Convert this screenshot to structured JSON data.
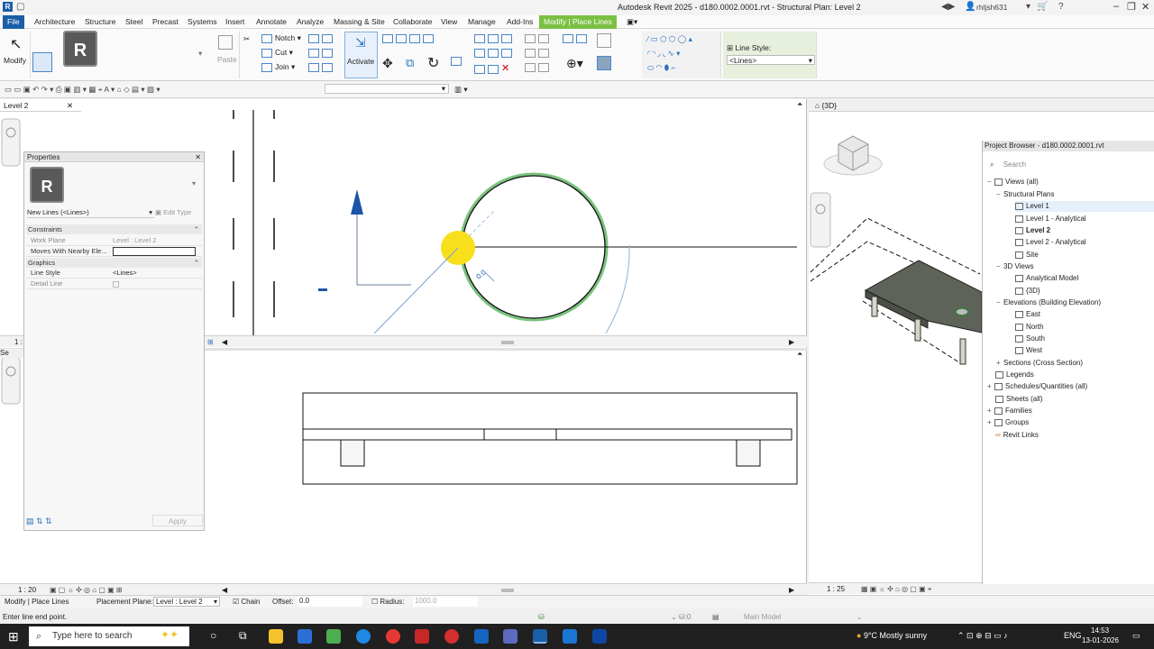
{
  "titlebar": {
    "title": "Autodesk Revit 2025 - d180.0002.0001.rvt - Structural Plan: Level 2",
    "user": "rhljsh631",
    "app_letter": "R"
  },
  "menu": {
    "tabs": [
      "File",
      "Architecture",
      "Structure",
      "Steel",
      "Precast",
      "Systems",
      "Insert",
      "Annotate",
      "Analyze",
      "Massing & Site",
      "Collaborate",
      "View",
      "Manage",
      "Add-Ins",
      "Modify | Place Lines"
    ]
  },
  "ribbon": {
    "modify_label": "Modify",
    "paste_label": "Paste",
    "notch_label": "Notch",
    "cut_label": "Cut",
    "join_label": "Join",
    "activate_label": "Activate",
    "line_style_label": "Line Style:",
    "line_style_value": "<Lines>"
  },
  "view_level2": {
    "tab_label": "Level 2",
    "scale": "1 : 20"
  },
  "view_3d": {
    "tab_label": "{3D}",
    "scale": "1 : 25"
  },
  "properties": {
    "title": "Properties",
    "type_selector": "New Lines (<Lines>)",
    "edit_type": "Edit Type",
    "sections": {
      "constraints": "Constraints",
      "graphics": "Graphics"
    },
    "rows": {
      "work_plane_k": "Work Plane",
      "work_plane_v": "Level : Level 2",
      "moves_k": "Moves With Nearby Ele...",
      "line_style_k": "Line Style",
      "line_style_v": "<Lines>",
      "detail_line_k": "Detail Line"
    },
    "apply": "Apply"
  },
  "browser": {
    "title": "Project Browser - d180.0002.0001.rvt",
    "search_placeholder": "Search",
    "items": {
      "views_all": "Views (all)",
      "structural_plans": "Structural Plans",
      "level1": "Level 1",
      "level1_analytical": "Level 1 - Analytical",
      "level2": "Level 2",
      "level2_analytical": "Level 2 - Analytical",
      "site": "Site",
      "views_3d": "3D Views",
      "analytical_model": "Analytical Model",
      "view_3d": "{3D}",
      "elevations": "Elevations (Building Elevation)",
      "east": "East",
      "north": "North",
      "south": "South",
      "west": "West",
      "sections": "Sections (Cross Section)",
      "legends": "Legends",
      "schedules": "Schedules/Quantities (all)",
      "sheets": "Sheets (all)",
      "families": "Families",
      "groups": "Groups",
      "revit_links": "Revit Links"
    }
  },
  "optionsbar": {
    "mode": "Modify | Place Lines",
    "placement_plane_label": "Placement Plane:",
    "placement_plane_value": "Level : Level 2",
    "chain_label": "Chain",
    "offset_label": "Offset:",
    "offset_value": "0.0",
    "radius_label": "Radius:",
    "radius_value": "1000.0"
  },
  "statusline": {
    "message": "Enter line end point.",
    "workset_value": ":0",
    "model": "Main Model"
  },
  "canvas": {
    "dimension_text": "0.0"
  },
  "taskbar": {
    "search_placeholder": "Type here to search",
    "weather": "9°C  Mostly sunny",
    "lang": "ENG",
    "time": "14:53",
    "date": "13-01-2026"
  }
}
